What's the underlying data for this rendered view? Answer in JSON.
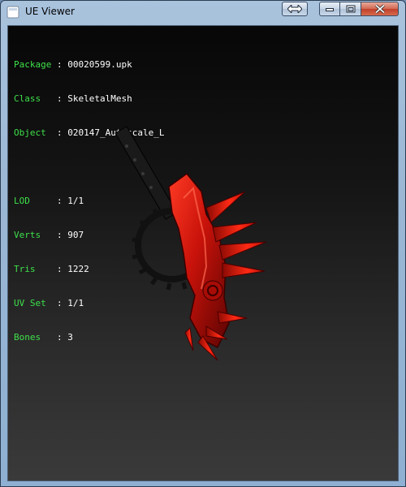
{
  "window": {
    "title": "UE Viewer"
  },
  "info": {
    "package": {
      "key": "Package",
      "sep": " : ",
      "value": "00020599.upk"
    },
    "class": {
      "key": "Class  ",
      "sep": " : ",
      "value": "SkeletalMesh"
    },
    "object": {
      "key": "Object ",
      "sep": " : ",
      "value": "020147_Autoscale_L"
    },
    "lod": {
      "key": "LOD    ",
      "sep": " : ",
      "value": "1/1"
    },
    "verts": {
      "key": "Verts  ",
      "sep": " : ",
      "value": "907"
    },
    "tris": {
      "key": "Tris   ",
      "sep": " : ",
      "value": "1222"
    },
    "uvset": {
      "key": "UV Set ",
      "sep": " : ",
      "value": "1/1"
    },
    "bones": {
      "key": "Bones  ",
      "sep": " : ",
      "value": "3"
    }
  },
  "colors": {
    "label": "#3ee04a",
    "value": "#ffffff",
    "model_red": "#c8120a"
  },
  "icons": {
    "app": "ue-viewer-app-icon",
    "extra": "resize-arrows-icon",
    "minimize": "minimize-icon",
    "maximize": "maximize-icon",
    "close": "close-icon"
  }
}
